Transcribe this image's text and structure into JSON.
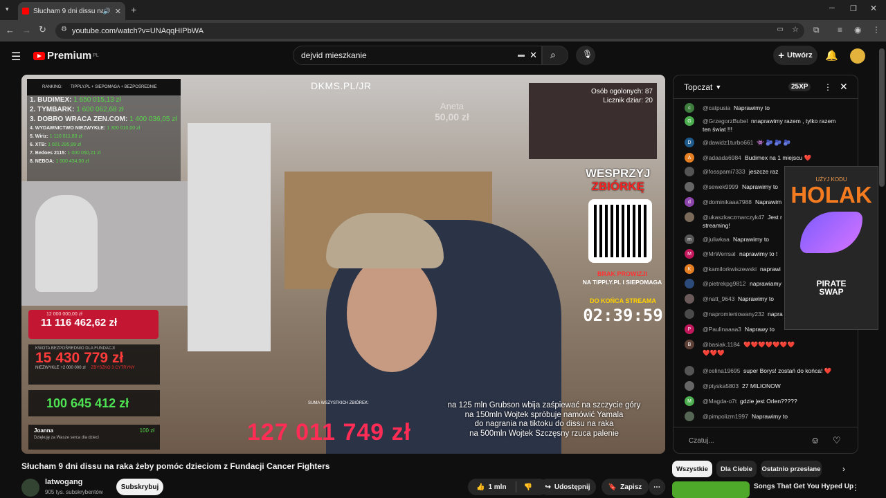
{
  "browser": {
    "tab_title": "Słucham 9 dni dissu na raka",
    "url": "youtube.com/watch?v=UNAqqHIPbWA"
  },
  "header": {
    "logo": "Premium",
    "logo_region": "PL",
    "search_value": "dejvid mieszkanie",
    "create_label": "Utwórz"
  },
  "video": {
    "ranking_label": "RANKING:",
    "ranking_source": "TIPPLY.PL + SIEPOMAGA + BEZPOŚREDNIE",
    "ranking": [
      {
        "name": "1. BUDIMEX:",
        "value": "1 650 015,13 zł"
      },
      {
        "name": "2. TYMBARK:",
        "value": "1 600 062,68 zł"
      },
      {
        "name": "3. DOBRO WRACA ZEN.COM:",
        "value": "1 400 036,05 zł"
      },
      {
        "name": "4. WYDAWNICTWO NIEZWYKŁE:",
        "value": "1 300 010,00 zł"
      },
      {
        "name": "5. Wiriz:",
        "value": "1 110 011,83 zł"
      },
      {
        "name": "6. XTB:",
        "value": "1 001 295,99 zł"
      },
      {
        "name": "7. Bedoes 2115:",
        "value": "1 000 050,21 zł"
      },
      {
        "name": "8. NEBOA:",
        "value": "1 000 434,00 zł"
      }
    ],
    "dkms": "DKMS.PL/JR",
    "ghost_name": "Aneta",
    "ghost_amount": "50,00 zł",
    "clip_people": "Osób ogolonych: 87",
    "clip_counter": "Licznik dziar: 20",
    "wesprzyj_1": "WESPRZYJ",
    "wesprzyj_2": "ZBIÓRKĘ",
    "brak_1": "BRAK PROWIZJI",
    "brak_2": "NA TIPPLY.PL I SIEPOMAGA",
    "do_konca": "DO KOŃCA STREAMA",
    "timer": "02:39:59",
    "goal_target": "12 000 000,00 zł",
    "goal_value": "11 116 462,62 zł",
    "fund_label": "KWOTA BEZPOŚREDNIO DLA FUNDACJI",
    "fund_value": "15 430 779 zł",
    "fund_note": "NIEZWYKŁE +2 000 000 zł",
    "fund_note2": "ZBYSZKO 3 CYTRYNY",
    "sum_value": "100 645 412 zł",
    "donor_name": "Joanna",
    "donor_amount": "100 zł",
    "donor_msg": "Dziękuję za Wasze serca dla dzieci",
    "total_label": "SUMA WSZYSTKICH ZBIÓREK:",
    "total_value": "127 011 749 zł",
    "caption": [
      "na 125 mln Grubson wbija zaśpiewać na szczycie góry",
      "na 150mln Wojtek spróbuje namówić Yamala",
      "do nagrania na tiktoku do dissu na raka",
      "na 500mln Wojtek Szczęsny rzuca palenie"
    ]
  },
  "below": {
    "title": "Słucham 9 dni dissu na raka żeby pomóc dzieciom z Fundacji Cancer Fighters",
    "channel": "latwogang",
    "subscribers": "905 tys. subskrybentów",
    "subscribe": "Subskrybuj",
    "likes": "1 mln",
    "share": "Udostępnij",
    "save": "Zapisz"
  },
  "chat": {
    "mode": "Topczat",
    "xp": "25XP",
    "input_placeholder": "Czatuj...",
    "messages": [
      {
        "initial": "c",
        "color": "#3e7d3e",
        "user": "@catpusia",
        "text": "Naprawimy to"
      },
      {
        "initial": "G",
        "color": "#4caf50",
        "user": "@GrzegorzBubel",
        "text": "nnaprawimy razem , tylko razem"
      },
      {
        "initial": "",
        "color": "#222222",
        "user": "",
        "text": "ten świat !!!"
      },
      {
        "initial": "D",
        "color": "#1e5a8c",
        "user": "@dawidz1turbo661",
        "text": "👾 🫐 🫐 🫐"
      },
      {
        "initial": "A",
        "color": "#e67e22",
        "user": "@adaada6984",
        "text": "Budimex na 1 miejscu ❤️"
      },
      {
        "initial": "",
        "color": "#555555",
        "user": "@fosspami7333",
        "text": "jeszcze raz"
      },
      {
        "initial": "",
        "color": "#666666",
        "user": "@sewek9999",
        "text": "Naprawimy to"
      },
      {
        "initial": "d",
        "color": "#8e44ad",
        "user": "@dominikaaa7988",
        "text": "Naprawim"
      },
      {
        "initial": "",
        "color": "#7a6a5a",
        "user": "@ukaszkaczmarczyk47",
        "text": "Jest r"
      },
      {
        "initial": "",
        "color": "#222222",
        "user": "",
        "text": "streaming!"
      },
      {
        "initial": "m",
        "color": "#555555",
        "user": "@juliwkaa",
        "text": "Naprawimy to"
      },
      {
        "initial": "M",
        "color": "#c2185b",
        "user": "@MrWerrsal",
        "text": "naprawimy to !"
      },
      {
        "initial": "K",
        "color": "#e67e22",
        "user": "@kamilorkwiszewski",
        "text": "naprawi"
      },
      {
        "initial": "",
        "color": "#2c4a7a",
        "user": "@pietrekpg9812",
        "text": "naprawiamy"
      },
      {
        "initial": "",
        "color": "#6a5a5a",
        "user": "@natt_9643",
        "text": "Naprawimy to"
      },
      {
        "initial": "",
        "color": "#4a4a4a",
        "user": "@napromieniowany232",
        "text": "napra"
      },
      {
        "initial": "P",
        "color": "#c2185b",
        "user": "@Paulinaaaa3",
        "text": "Naprawy to"
      },
      {
        "initial": "B",
        "color": "#5d4037",
        "user": "@basiak.1184",
        "text": "❤️❤️❤️❤️❤️❤️❤️"
      },
      {
        "initial": "",
        "color": "#222222",
        "user": "",
        "text": "❤️❤️❤️"
      },
      {
        "initial": "",
        "color": "#555555",
        "user": "@celina19695",
        "text": "super Borys! zostań do końca! ❤️"
      },
      {
        "initial": "",
        "color": "#666666",
        "user": "@ptyska5803",
        "text": "27 MILIONOW"
      },
      {
        "initial": "M",
        "color": "#4caf50",
        "user": "@Magda-o7t",
        "text": "gdzie jest Orlen?????"
      },
      {
        "initial": "",
        "color": "#556655",
        "user": "@pimpolizm1997",
        "text": "Naprawimy to"
      }
    ]
  },
  "ad": {
    "kicker": "UŻYJ KODU",
    "code": "HOLAK",
    "brand_1": "PIRATE",
    "brand_2": "SWAP"
  },
  "chips": [
    "Wszystkie",
    "Dla Ciebie",
    "Ostatnio przesłane"
  ],
  "next_video": "Songs That Get You Hyped Up"
}
